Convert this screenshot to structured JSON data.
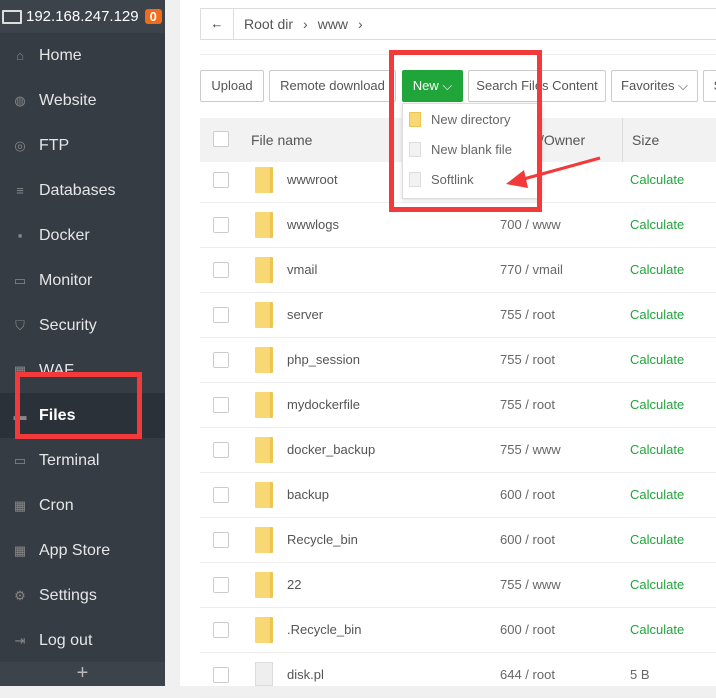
{
  "sidebar": {
    "host": "192.168.247.129",
    "badge": "0",
    "items": [
      {
        "label": "Home",
        "icon": "home-icon"
      },
      {
        "label": "Website",
        "icon": "globe-icon"
      },
      {
        "label": "FTP",
        "icon": "ftp-icon"
      },
      {
        "label": "Databases",
        "icon": "database-icon"
      },
      {
        "label": "Docker",
        "icon": "docker-icon"
      },
      {
        "label": "Monitor",
        "icon": "monitor-icon"
      },
      {
        "label": "Security",
        "icon": "shield-icon"
      },
      {
        "label": "WAF",
        "icon": "waf-icon"
      },
      {
        "label": "Files",
        "icon": "folder-icon"
      },
      {
        "label": "Terminal",
        "icon": "terminal-icon"
      },
      {
        "label": "Cron",
        "icon": "calendar-icon"
      },
      {
        "label": "App Store",
        "icon": "grid-icon"
      },
      {
        "label": "Settings",
        "icon": "gear-icon"
      },
      {
        "label": "Log out",
        "icon": "logout-icon"
      }
    ],
    "plus": "+"
  },
  "breadcrumb": {
    "back": "←",
    "items": [
      "Root dir",
      "›",
      "www",
      "›"
    ]
  },
  "toolbar": {
    "upload": "Upload",
    "remote": "Remote download",
    "new": "New ⌵",
    "search": "Search Files Content",
    "favorites": "Favorites ⌵",
    "more": "S"
  },
  "new_menu": [
    "New directory",
    "New blank file",
    "Softlink"
  ],
  "table": {
    "headers": {
      "name": "File name",
      "perm": "/Owner",
      "size": "Size"
    },
    "rows": [
      {
        "name": "wwwroot",
        "perm": "oot",
        "size": "Calculate",
        "type": "folder"
      },
      {
        "name": "wwwlogs",
        "perm": "700 / www",
        "size": "Calculate",
        "type": "folder"
      },
      {
        "name": "vmail",
        "perm": "770 / vmail",
        "size": "Calculate",
        "type": "folder"
      },
      {
        "name": "server",
        "perm": "755 / root",
        "size": "Calculate",
        "type": "folder"
      },
      {
        "name": "php_session",
        "perm": "755 / root",
        "size": "Calculate",
        "type": "folder"
      },
      {
        "name": "mydockerfile",
        "perm": "755 / root",
        "size": "Calculate",
        "type": "folder"
      },
      {
        "name": "docker_backup",
        "perm": "755 / www",
        "size": "Calculate",
        "type": "folder"
      },
      {
        "name": "backup",
        "perm": "600 / root",
        "size": "Calculate",
        "type": "folder"
      },
      {
        "name": "Recycle_bin",
        "perm": "600 / root",
        "size": "Calculate",
        "type": "folder"
      },
      {
        "name": "22",
        "perm": "755 / www",
        "size": "Calculate",
        "type": "folder"
      },
      {
        "name": ".Recycle_bin",
        "perm": "600 / root",
        "size": "Calculate",
        "type": "folder"
      },
      {
        "name": "disk.pl",
        "perm": "644 / root",
        "size": "5 B",
        "type": "file"
      }
    ]
  },
  "colors": {
    "accent": "#20a53a",
    "highlight": "#f23a3a",
    "sidebar": "#353c44"
  }
}
